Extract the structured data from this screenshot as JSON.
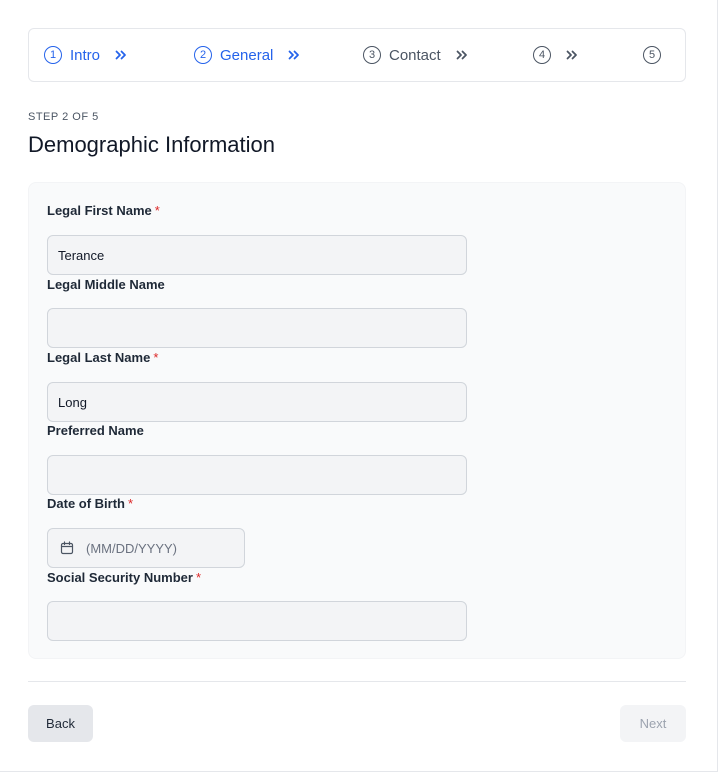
{
  "stepper": {
    "steps": [
      {
        "number": "1",
        "label": "Intro",
        "state": "active"
      },
      {
        "number": "2",
        "label": "General",
        "state": "active"
      },
      {
        "number": "3",
        "label": "Contact",
        "state": "inactive"
      },
      {
        "number": "4",
        "label": "",
        "state": "inactive"
      },
      {
        "number": "5",
        "label": "",
        "state": "inactive"
      }
    ]
  },
  "header": {
    "step_counter": "STEP 2 OF 5",
    "title": "Demographic Information"
  },
  "form": {
    "required_marker": "*",
    "first_name": {
      "label": "Legal First Name",
      "value": "Terance"
    },
    "middle_name": {
      "label": "Legal Middle Name",
      "value": ""
    },
    "last_name": {
      "label": "Legal Last Name",
      "value": "Long"
    },
    "preferred_name": {
      "label": "Preferred Name",
      "value": ""
    },
    "dob": {
      "label": "Date of Birth",
      "placeholder": "(MM/DD/YYYY)",
      "value": ""
    },
    "ssn": {
      "label": "Social Security Number",
      "value": ""
    }
  },
  "footer": {
    "back_label": "Back",
    "next_label": "Next"
  },
  "colors": {
    "accent": "#2563eb",
    "required": "#dc2626",
    "inactive_step": "#4b5563"
  },
  "icons": {
    "step_separator": "chevron-double-right-icon",
    "date": "calendar-icon"
  }
}
